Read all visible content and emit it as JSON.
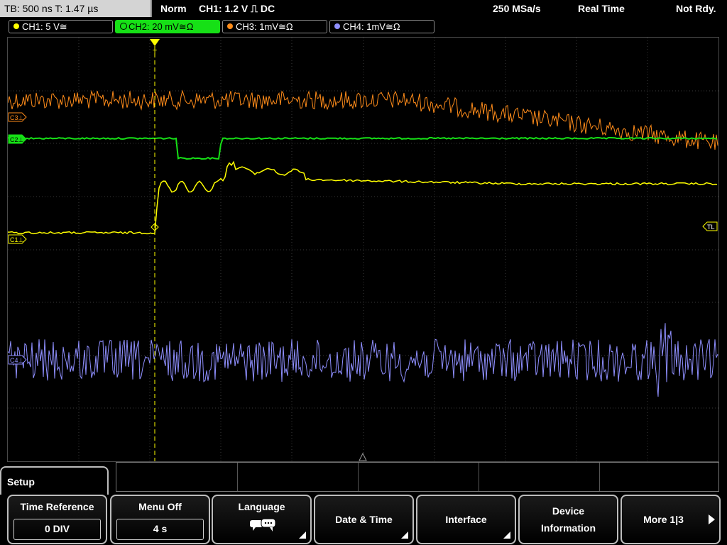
{
  "status": {
    "tb": "TB: 500 ns   T: 1.47 µs",
    "mode": "Norm",
    "trigger": "CH1: 1.2 V ⎍ DC",
    "sample_rate": "250 MSa/s",
    "acq": "Real Time",
    "state": "Not Rdy."
  },
  "channels": [
    {
      "label": "CH1: 5 V≅",
      "color": "#ffff00"
    },
    {
      "label": "CH2: 20 mV≅Ω",
      "color": "#16e016"
    },
    {
      "label": "CH3: 1mV≅Ω",
      "color": "#ff8c1a"
    },
    {
      "label": "CH4: 1mV≅Ω",
      "color": "#8f8fff"
    }
  ],
  "markers": {
    "c3": "C3⊥",
    "c2": "C2⊥",
    "c1": "C1⊥",
    "c4": "C4⊥",
    "tl": "TL",
    "trig": "T"
  },
  "menu": {
    "title": "Setup",
    "softkeys": {
      "time_ref": "Time Reference",
      "time_ref_val": "0 DIV",
      "menu_off": "Menu Off",
      "menu_off_val": "4 s",
      "language": "Language",
      "language_icon": "speech-bubble-icon",
      "date_time": "Date & Time",
      "interface": "Interface",
      "device_info_1": "Device",
      "device_info_2": "Information",
      "more": "More 1|3"
    }
  }
}
